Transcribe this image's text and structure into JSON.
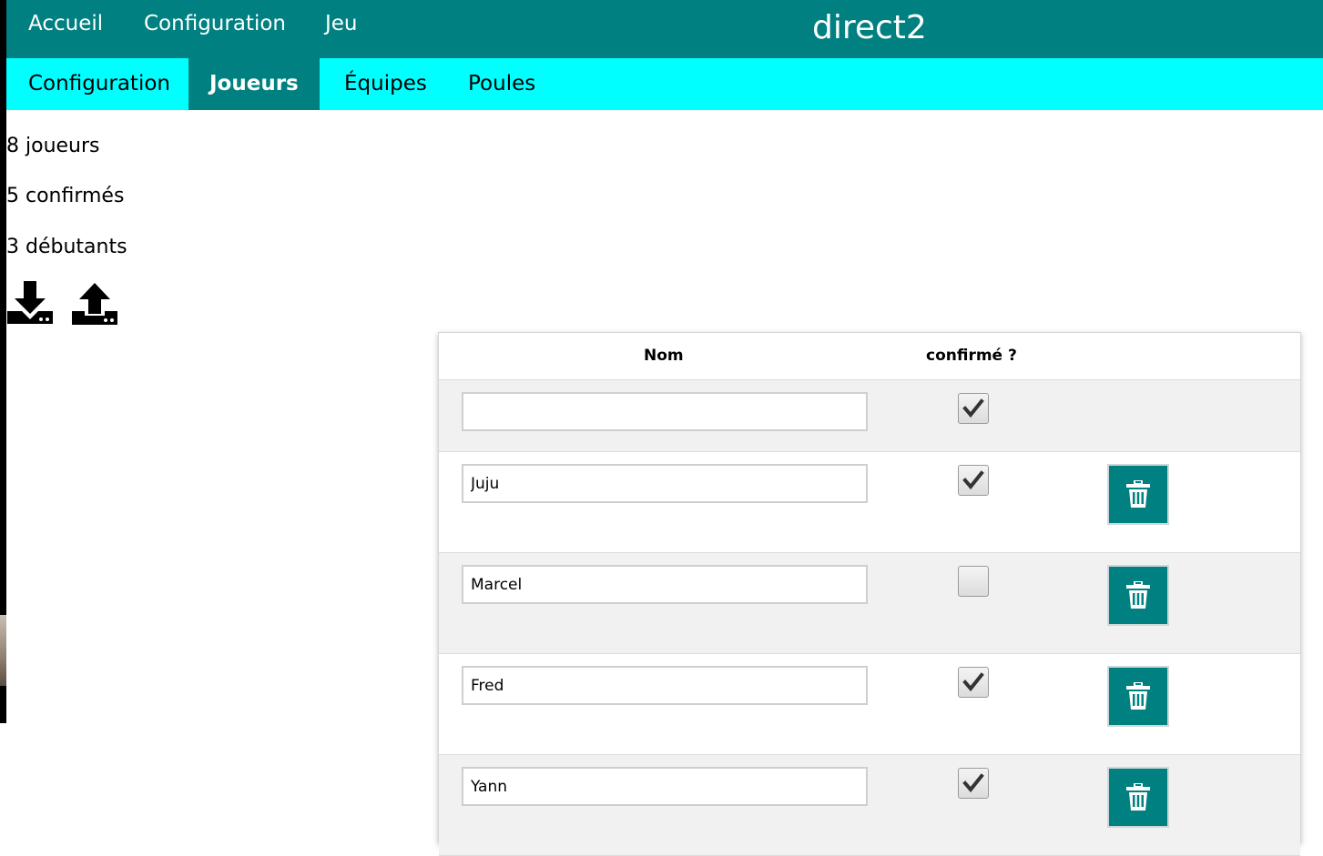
{
  "colors": {
    "primary": "#008080",
    "secondary": "#00ffff",
    "row_alt": "#f1f1f1"
  },
  "topnav": {
    "links": [
      "Accueil",
      "Configuration",
      "Jeu"
    ],
    "title": "direct2"
  },
  "subnav": {
    "tabs": [
      "Configuration",
      "Joueurs",
      "Équipes",
      "Poules"
    ],
    "active_tab": "Joueurs"
  },
  "stats": {
    "players": "8 joueurs",
    "confirmed": "5 confirmés",
    "beginners": "3 débutants"
  },
  "icons": {
    "download": "download-icon",
    "upload": "upload-icon",
    "delete": "trash-icon",
    "check": "checkmark-icon"
  },
  "table": {
    "headers": {
      "name": "Nom",
      "confirmed": "confirmé ?"
    },
    "new_row": {
      "name": "",
      "confirmed": true
    },
    "rows": [
      {
        "name": "Juju",
        "confirmed": true
      },
      {
        "name": "Marcel",
        "confirmed": false
      },
      {
        "name": "Fred",
        "confirmed": true
      },
      {
        "name": "Yann",
        "confirmed": true
      }
    ]
  }
}
